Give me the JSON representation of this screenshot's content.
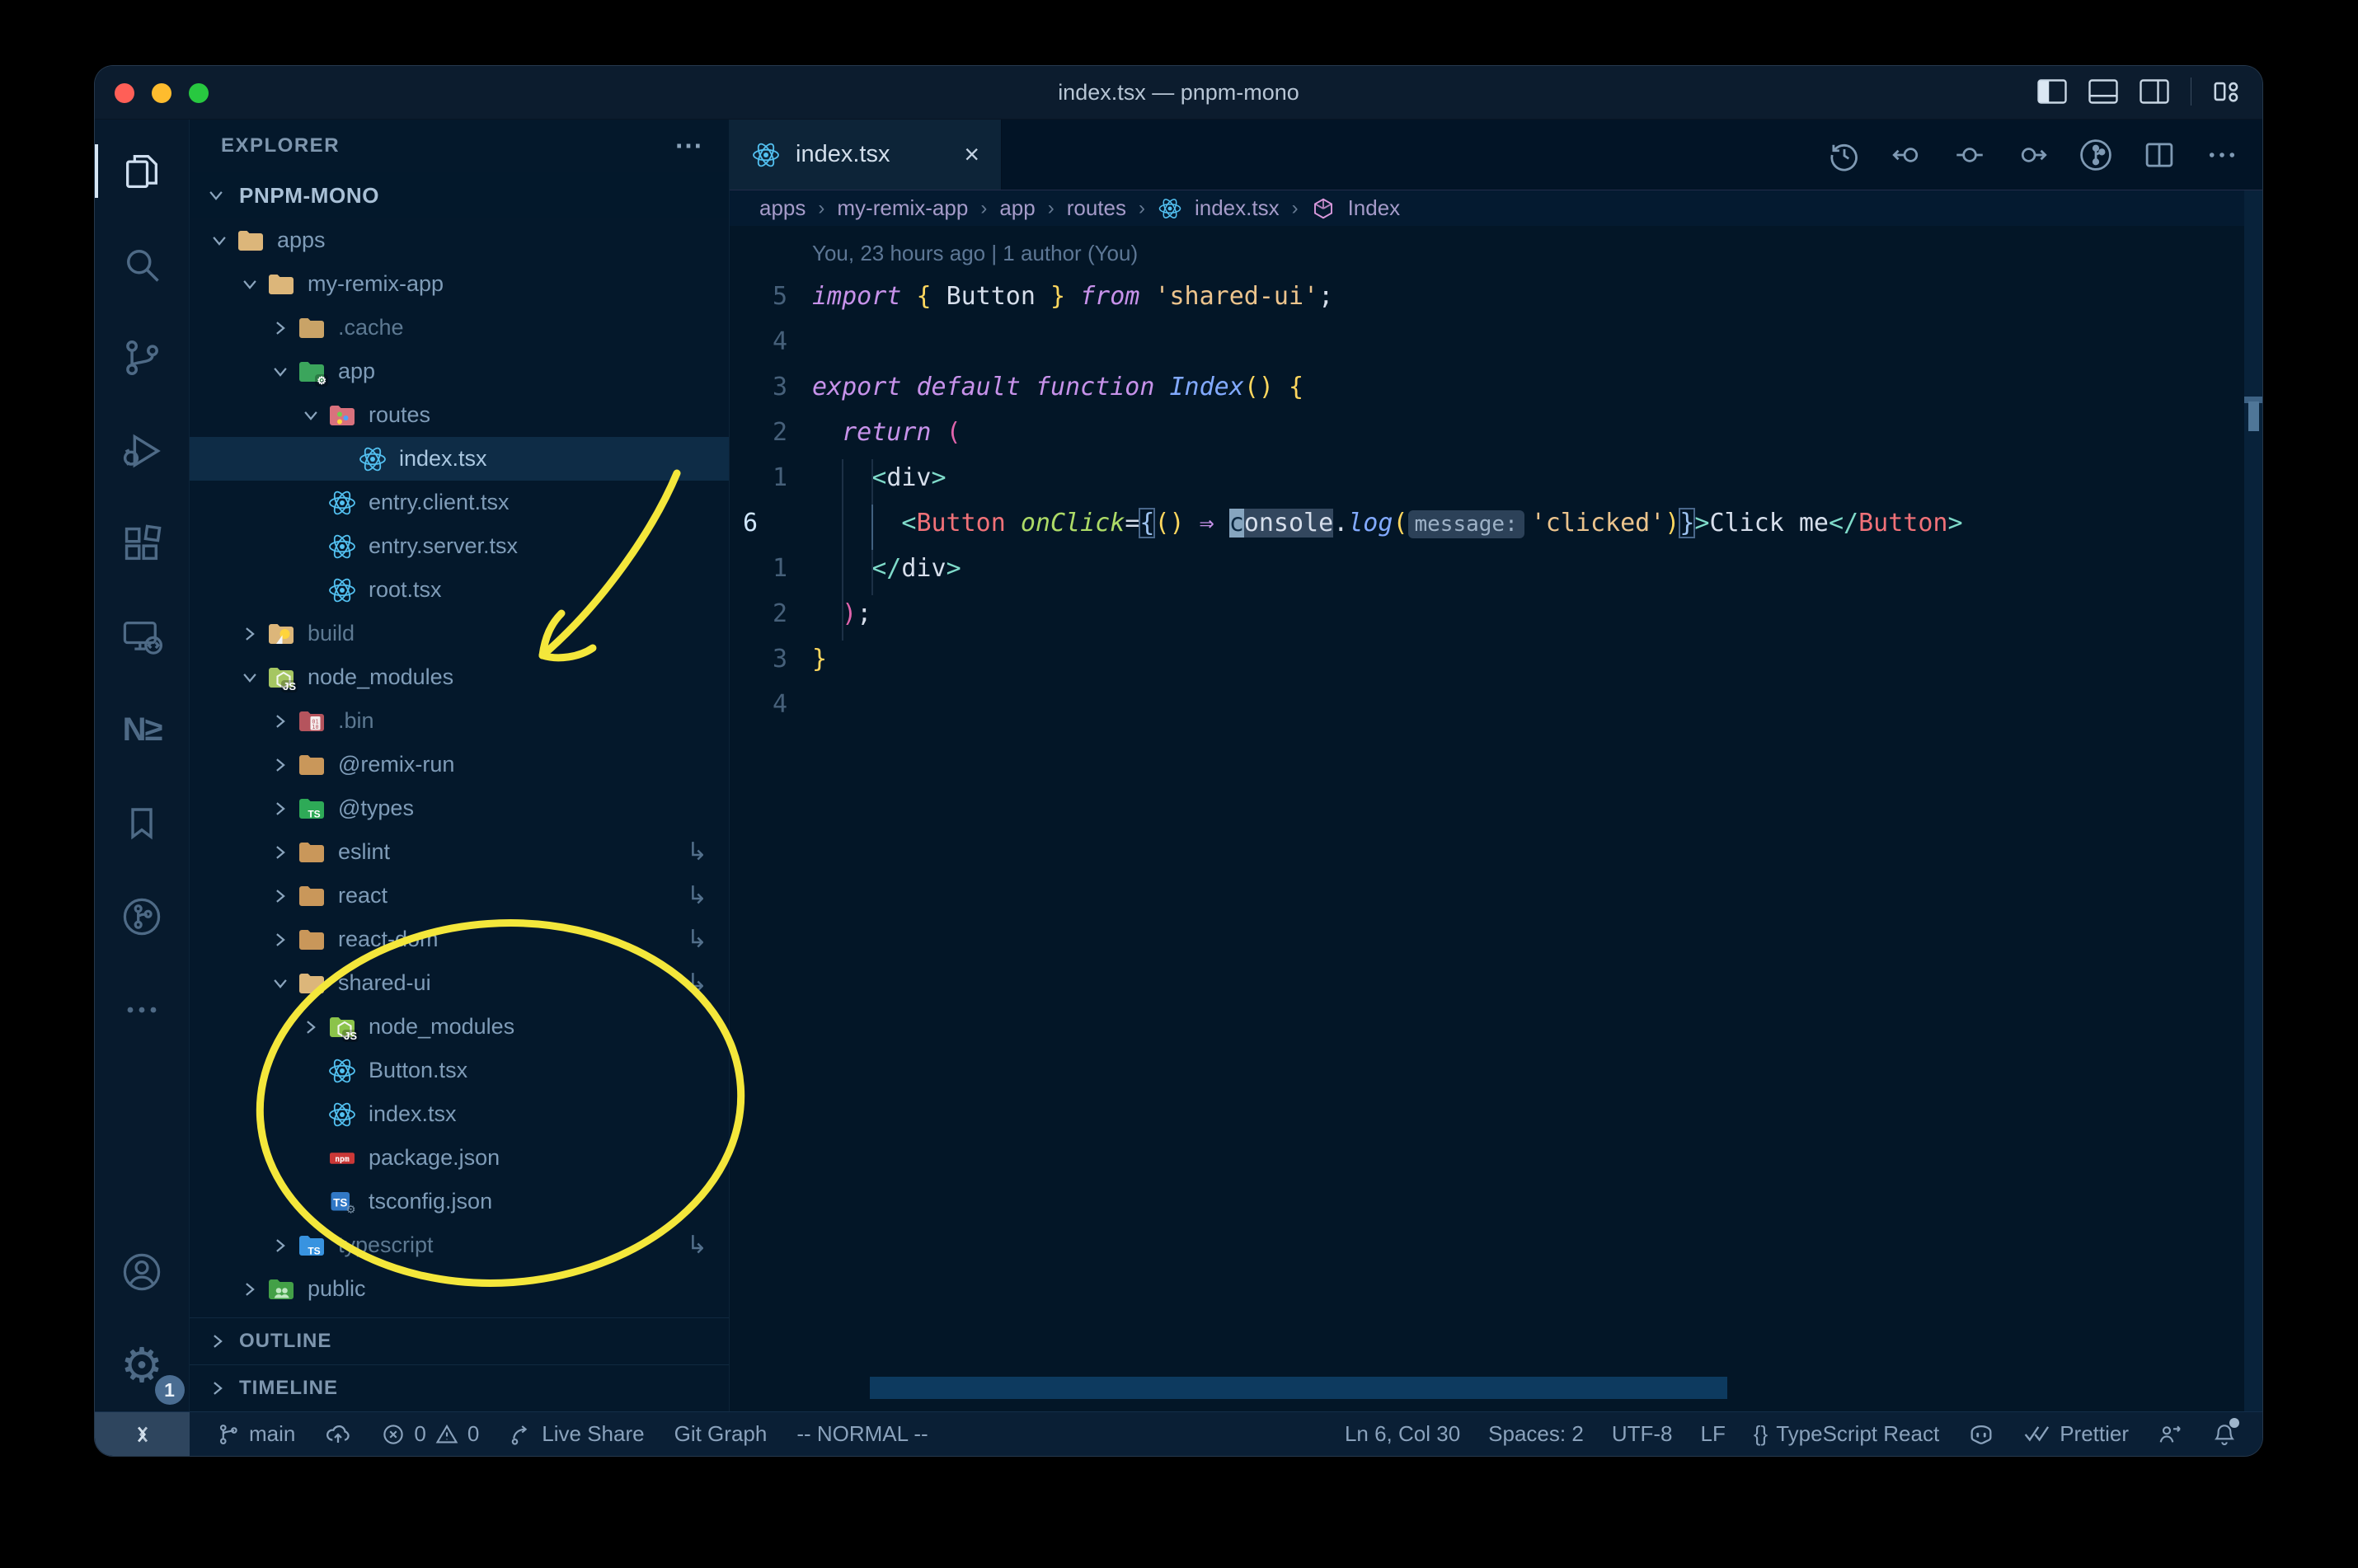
{
  "window": {
    "title": "index.tsx — pnpm-mono"
  },
  "titlebar_icons": [
    "toggle-primary-sidebar",
    "toggle-panel",
    "toggle-secondary-sidebar",
    "customize-layout"
  ],
  "activity_bar": {
    "items": [
      "explorer",
      "search",
      "source-control",
      "run-and-debug",
      "extensions",
      "remote-explorer",
      "nx-console",
      "bookmarks",
      "git-graph",
      "more",
      "accounts",
      "settings"
    ],
    "nx_glyph": "N≥",
    "settings_badge": "1"
  },
  "explorer": {
    "header": "EXPLORER",
    "header_more": "⋯",
    "project": "PNPM-MONO",
    "tree": [
      {
        "label": "apps"
      },
      {
        "label": "my-remix-app"
      },
      {
        "label": ".cache"
      },
      {
        "label": "app"
      },
      {
        "label": "routes"
      },
      {
        "label": "index.tsx"
      },
      {
        "label": "entry.client.tsx"
      },
      {
        "label": "entry.server.tsx"
      },
      {
        "label": "root.tsx"
      },
      {
        "label": "build"
      },
      {
        "label": "node_modules"
      },
      {
        "label": ".bin"
      },
      {
        "label": "@remix-run"
      },
      {
        "label": "@types"
      },
      {
        "label": "eslint"
      },
      {
        "label": "react"
      },
      {
        "label": "react-dom"
      },
      {
        "label": "shared-ui"
      },
      {
        "label": "node_modules"
      },
      {
        "label": "Button.tsx"
      },
      {
        "label": "index.tsx"
      },
      {
        "label": "package.json"
      },
      {
        "label": "tsconfig.json"
      },
      {
        "label": "typescript"
      },
      {
        "label": "public"
      }
    ],
    "symlink_glyph": "↳",
    "outline": "OUTLINE",
    "timeline": "TIMELINE"
  },
  "tabs": {
    "active_label": "index.tsx",
    "close_glyph": "×"
  },
  "editor_actions": [
    "timeline-history",
    "previous-change",
    "current-change",
    "next-change",
    "git-graph",
    "split-editor",
    "more-actions"
  ],
  "breadcrumbs": {
    "sep": "›",
    "items": [
      "apps",
      "my-remix-app",
      "app",
      "routes",
      "index.tsx",
      "Index"
    ]
  },
  "editor": {
    "blame": "You, 23 hours ago | 1 author (You)",
    "lines": [
      {
        "num": "5",
        "tokens": [
          "import",
          " ",
          "{",
          " ",
          "Button",
          " ",
          "}",
          " ",
          "from",
          " ",
          "'shared-ui'",
          ";"
        ]
      },
      {
        "num": "4",
        "tokens": []
      },
      {
        "num": "3",
        "tokens": [
          "export",
          " ",
          "default",
          " ",
          "function",
          " ",
          "Index",
          "(",
          ")",
          " ",
          "{"
        ]
      },
      {
        "num": "2",
        "tokens": [
          "  ",
          "return",
          " ",
          "("
        ]
      },
      {
        "num": "1",
        "tokens": [
          "    ",
          "<",
          "div",
          ">"
        ]
      },
      {
        "num": "6",
        "tokens": [
          "      ",
          "<",
          "Button",
          " ",
          "onClick",
          "=",
          "{",
          "(",
          ")",
          " ",
          "⇒",
          " ",
          "c",
          "onsole",
          ".",
          "log",
          "(",
          "message:",
          " ",
          "'clicked'",
          ")",
          "}",
          ">",
          "Click me",
          "</",
          "Button",
          ">"
        ]
      },
      {
        "num": "1",
        "tokens": [
          "    ",
          "</",
          "div",
          ">"
        ]
      },
      {
        "num": "2",
        "tokens": [
          "  ",
          ")",
          ";"
        ]
      },
      {
        "num": "3",
        "tokens": [
          "}"
        ]
      },
      {
        "num": "4",
        "tokens": []
      }
    ]
  },
  "status_bar": {
    "branch": "main",
    "errors": "0",
    "warnings": "0",
    "live_share": "Live Share",
    "git_graph": "Git Graph",
    "mode": "-- NORMAL --",
    "line_col": "Ln 6, Col 30",
    "spaces": "Spaces: 2",
    "encoding": "UTF-8",
    "eol": "LF",
    "braces_glyph": "{}",
    "language": "TypeScript React",
    "prettier": "Prettier"
  },
  "icons": {
    "react-icon": "atom",
    "npm-icon": "npm",
    "ts-icon": "TS",
    "folder-icon": "folder",
    "chevron-right-icon": "›",
    "chevron-down-icon": "⌄",
    "close-icon": "×",
    "more-icon": "⋯",
    "settings-icon": "⚙",
    "symlink-icon": "↳",
    "error-icon": "⊗",
    "warning-icon": "⚠",
    "bell-icon": "bell",
    "branch-icon": "branch",
    "cloud-upload-icon": "cloud-up",
    "remote-icon": "><"
  },
  "colors": {
    "editor_bg": "#031627",
    "sidebar_bg": "#04182b",
    "titlebar_bg": "#0c1c2e",
    "statusbar_bg": "#0a1f35",
    "annotation_yellow": "#f4e73b",
    "keyword": "#c792ea",
    "string": "#ecc48d",
    "tag": "#f07178",
    "attribute": "#addb67",
    "function": "#82aaff",
    "punct_teal": "#7fdbca",
    "bracket_gold": "#ffd75e",
    "bracket_pink": "#e064ac",
    "selection_row": "#0e2c46",
    "traffic_red": "#ff5f57",
    "traffic_yellow": "#febc2e",
    "traffic_green": "#28c840"
  }
}
